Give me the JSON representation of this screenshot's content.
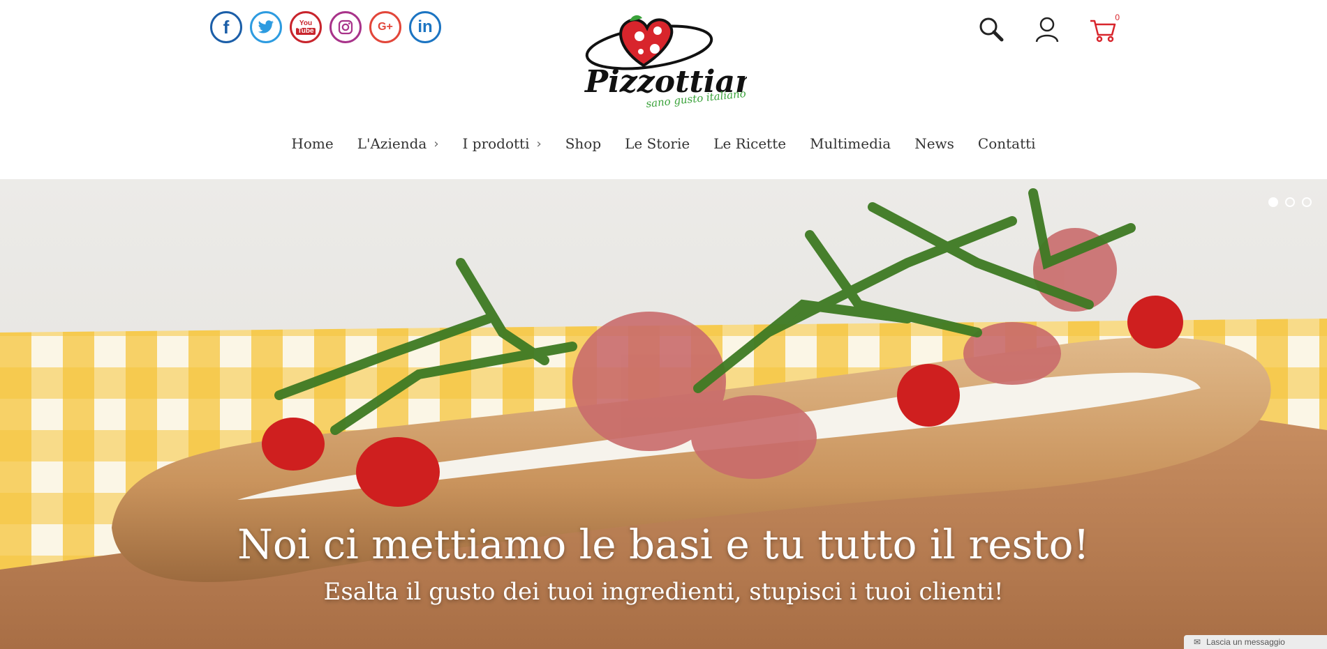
{
  "header": {
    "social": {
      "facebook": "f",
      "twitter": "twitter-icon",
      "youtube_top": "You",
      "youtube_bottom": "Tube",
      "instagram": "instagram-icon",
      "google_plus": "G+",
      "linkedin": "in"
    },
    "logo": {
      "name": "Pizzottiamo",
      "tagline": "sano gusto italiano"
    },
    "cart_count": "0"
  },
  "nav": {
    "items": [
      {
        "label": "Home",
        "has_submenu": false
      },
      {
        "label": "L'Azienda",
        "has_submenu": true
      },
      {
        "label": "I prodotti",
        "has_submenu": true
      },
      {
        "label": "Shop",
        "has_submenu": false
      },
      {
        "label": "Le Storie",
        "has_submenu": false
      },
      {
        "label": "Le Ricette",
        "has_submenu": false
      },
      {
        "label": "Multimedia",
        "has_submenu": false
      },
      {
        "label": "News",
        "has_submenu": false
      },
      {
        "label": "Contatti",
        "has_submenu": false
      }
    ],
    "chevron": "›"
  },
  "hero": {
    "headline": "Noi ci mettiamo le basi e tu tutto il resto!",
    "subline": "Esalta il gusto dei tuoi ingredienti, stupisci i tuoi clienti!",
    "slides_total": 3,
    "active_slide": 1
  },
  "chat": {
    "label": "Lascia un messaggio"
  },
  "colors": {
    "brand_red": "#d8252c",
    "brand_green": "#3aa23a",
    "text": "#333333"
  }
}
